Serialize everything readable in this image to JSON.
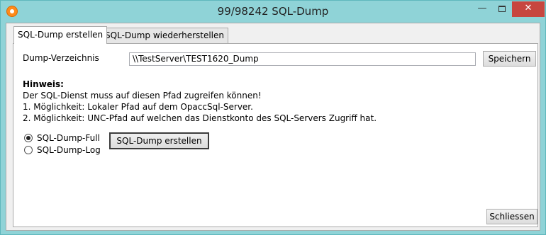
{
  "window": {
    "title": "99/98242 SQL-Dump",
    "minimize_symbol": "—",
    "close_symbol": "✕"
  },
  "tabs": [
    {
      "label": "SQL-Dump erstellen",
      "active": true
    },
    {
      "label": "SQL-Dump wiederherstellen",
      "active": false
    }
  ],
  "form": {
    "dir_label": "Dump-Verzeichnis",
    "dir_value": "\\\\TestServer\\TEST1620_Dump",
    "save_label": "Speichern"
  },
  "hint": {
    "title": "Hinweis:",
    "line1": "Der SQL-Dienst muss auf diesen Pfad zugreifen können!",
    "line2": "1. Möglichkeit: Lokaler Pfad auf dem OpaccSql-Server.",
    "line3": "2. Möglichkeit: UNC-Pfad auf welchen das Dienstkonto des SQL-Servers Zugriff hat."
  },
  "options": [
    {
      "label": "SQL-Dump-Full",
      "checked": true
    },
    {
      "label": "SQL-Dump-Log",
      "checked": false
    }
  ],
  "actions": {
    "create_label": "SQL-Dump erstellen",
    "close_label": "Schliessen"
  },
  "colors": {
    "titlebar": "#8fd3d7",
    "close_button": "#c7463f",
    "app_icon": "#ff8a1a"
  },
  "icons": [
    "app-icon",
    "minimize-icon",
    "maximize-icon",
    "close-icon"
  ]
}
